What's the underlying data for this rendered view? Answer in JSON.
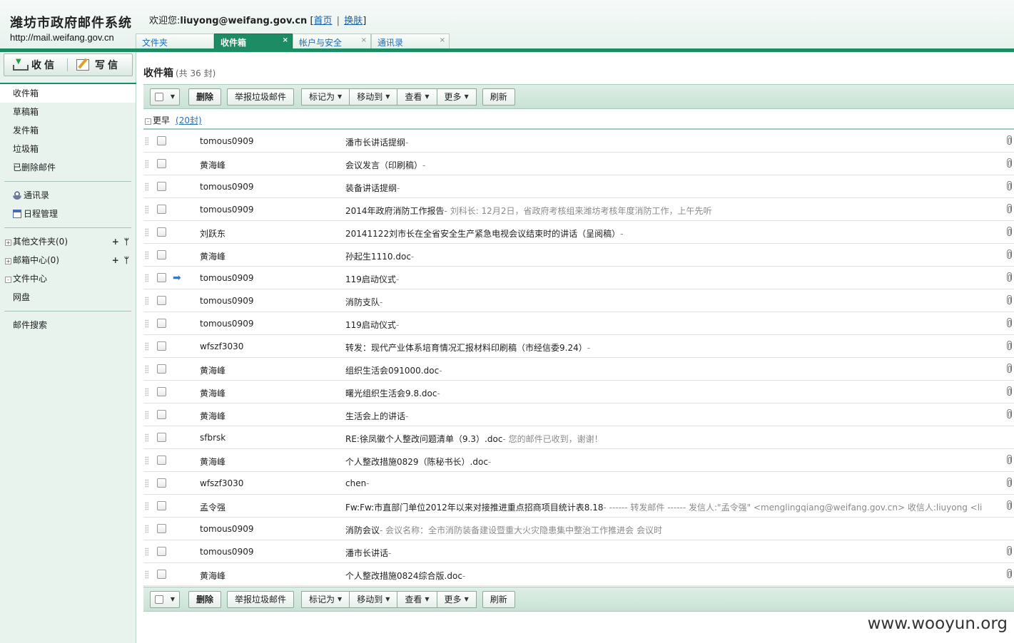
{
  "header": {
    "title": "潍坊市政府邮件系统",
    "url": "http://mail.weifang.gov.cn",
    "welcome_prefix": "欢迎您:",
    "user": "liuyong@weifang.gov.cn",
    "home_link": "首页",
    "skin_link": "换肤",
    "bracket_open": "[",
    "bracket_close": "]",
    "sep": "|"
  },
  "tabs": [
    {
      "label": "文件夹",
      "close": ""
    },
    {
      "label": "收件箱",
      "close": "×"
    },
    {
      "label": "帐户与安全",
      "close": "×"
    },
    {
      "label": "通讯录",
      "close": "×"
    }
  ],
  "actions": {
    "receive": "收信",
    "compose": "写信"
  },
  "sidebar": {
    "folders": [
      "收件箱",
      "草稿箱",
      "发件箱",
      "垃圾箱",
      "已删除邮件"
    ],
    "tools": [
      "通讯录",
      "日程管理"
    ],
    "tree": [
      {
        "toggle": "+",
        "label": "其他文件夹(0)",
        "add": "+",
        "more": "ᛘ"
      },
      {
        "toggle": "+",
        "label": "邮箱中心(0)",
        "add": "+",
        "more": "ᛘ"
      },
      {
        "toggle": "-",
        "label": "文件中心",
        "add": "",
        "more": ""
      }
    ],
    "netdisk": "网盘",
    "search": "邮件搜索"
  },
  "main": {
    "title": "收件箱",
    "count": "(共 36 封)",
    "toolbar": {
      "delete": "删除",
      "report_spam": "举报垃圾邮件",
      "mark_as": "标记为",
      "move_to": "移动到",
      "view": "查看",
      "more": "更多",
      "refresh": "刷新"
    },
    "group": {
      "toggle": "-",
      "label": "更早",
      "count": "(20封)"
    },
    "mails": [
      {
        "sender": "tomous0909",
        "subject": "潘市长讲话提纲",
        "preview": "-",
        "attachment": true,
        "forwarded": false
      },
      {
        "sender": "黄海峰",
        "subject": "会议发言（印刷稿）",
        "preview": "-",
        "attachment": true,
        "forwarded": false
      },
      {
        "sender": "tomous0909",
        "subject": "装备讲话提纲",
        "preview": "-",
        "attachment": true,
        "forwarded": false
      },
      {
        "sender": "tomous0909",
        "subject": "2014年政府消防工作报告",
        "preview": "- 刘科长:        12月2日，省政府考核组来潍坊考核年度消防工作，上午先听",
        "attachment": true,
        "forwarded": false
      },
      {
        "sender": "刘跃东",
        "subject": "20141122刘市长在全省安全生产紧急电视会议结束时的讲话（呈阅稿）",
        "preview": "-",
        "attachment": true,
        "forwarded": false
      },
      {
        "sender": "黄海峰",
        "subject": "孙起生1110.doc",
        "preview": "-",
        "attachment": true,
        "forwarded": false
      },
      {
        "sender": "tomous0909",
        "subject": "119启动仪式",
        "preview": "-",
        "attachment": true,
        "forwarded": true
      },
      {
        "sender": "tomous0909",
        "subject": "消防支队",
        "preview": "-",
        "attachment": true,
        "forwarded": false
      },
      {
        "sender": "tomous0909",
        "subject": "119启动仪式",
        "preview": "-",
        "attachment": true,
        "forwarded": false
      },
      {
        "sender": "wfszf3030",
        "subject": "转发：现代产业体系培育情况汇报材料印刷稿（市经信委9.24）",
        "preview": "-",
        "attachment": true,
        "forwarded": false
      },
      {
        "sender": "黄海峰",
        "subject": "组织生活会091000.doc",
        "preview": "-",
        "attachment": true,
        "forwarded": false
      },
      {
        "sender": "黄海峰",
        "subject": "曙光组织生活会9.8.doc",
        "preview": "-",
        "attachment": true,
        "forwarded": false
      },
      {
        "sender": "黄海峰",
        "subject": "生活会上的讲话",
        "preview": "-",
        "attachment": true,
        "forwarded": false
      },
      {
        "sender": "sfbrsk",
        "subject": "RE:徐凤徽个人整改问题清单（9.3）.doc",
        "preview": "- 您的邮件已收到，谢谢！",
        "attachment": false,
        "forwarded": false
      },
      {
        "sender": "黄海峰",
        "subject": "个人整改措施0829（陈秘书长）.doc",
        "preview": "-",
        "attachment": true,
        "forwarded": false
      },
      {
        "sender": "wfszf3030",
        "subject": "chen",
        "preview": "-",
        "attachment": true,
        "forwarded": false
      },
      {
        "sender": "孟令强",
        "subject": "Fw:Fw:市直部门单位2012年以来对接推进重点招商项目统计表8.18",
        "preview": "- ------ 转发邮件 ------ 发信人:\"孟令强\" <menglingqiang@weifang.gov.cn> 收信人:liuyong <li",
        "attachment": true,
        "forwarded": false
      },
      {
        "sender": "tomous0909",
        "subject": "消防会议",
        "preview": "- 会议名称：全市消防装备建设暨重大火灾隐患集中整治工作推进会 会议时",
        "attachment": false,
        "forwarded": false
      },
      {
        "sender": "tomous0909",
        "subject": "潘市长讲话",
        "preview": "-",
        "attachment": true,
        "forwarded": false
      },
      {
        "sender": "黄海峰",
        "subject": "个人整改措施0824综合版.doc",
        "preview": "-",
        "attachment": true,
        "forwarded": false
      }
    ]
  },
  "watermark": "www.wooyun.org"
}
